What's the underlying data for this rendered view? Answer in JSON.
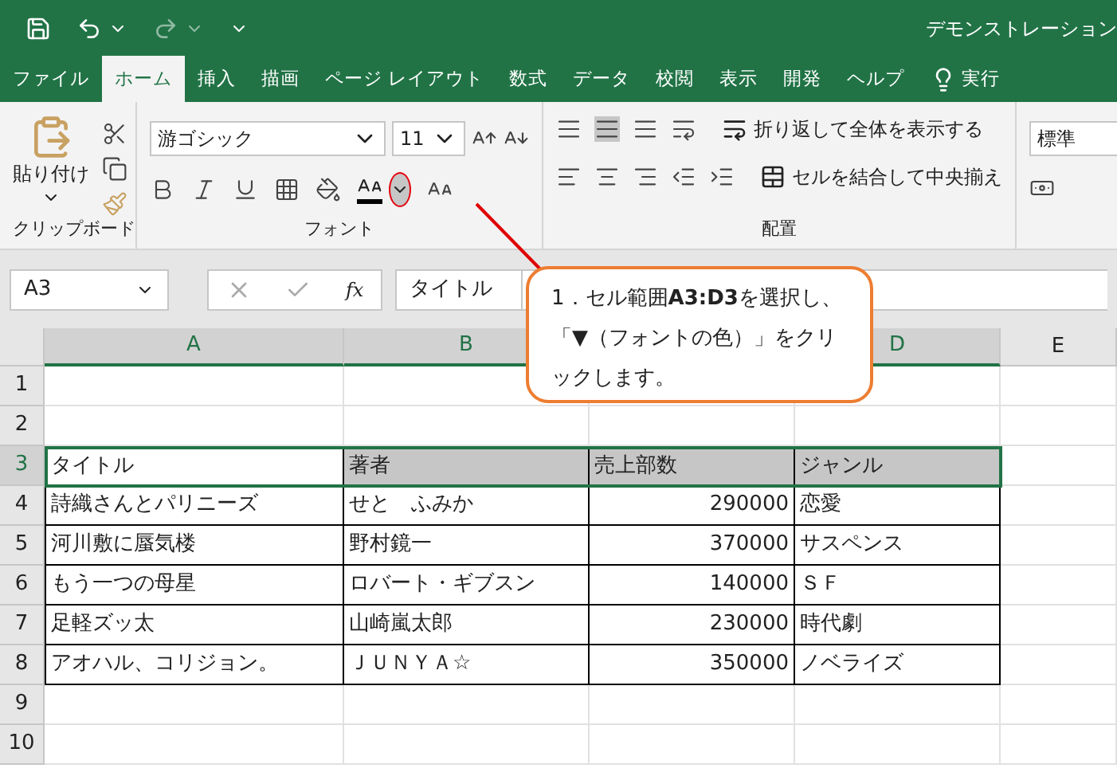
{
  "window": {
    "title": "デモンストレーション"
  },
  "ribbon_tabs": [
    {
      "label": "ファイル",
      "selected": false
    },
    {
      "label": "ホーム",
      "selected": true
    },
    {
      "label": "挿入",
      "selected": false
    },
    {
      "label": "描画",
      "selected": false
    },
    {
      "label": "ページ レイアウト",
      "selected": false
    },
    {
      "label": "数式",
      "selected": false
    },
    {
      "label": "データ",
      "selected": false
    },
    {
      "label": "校閲",
      "selected": false
    },
    {
      "label": "表示",
      "selected": false
    },
    {
      "label": "開発",
      "selected": false
    },
    {
      "label": "ヘルプ",
      "selected": false
    },
    {
      "label": "実行",
      "selected": false
    }
  ],
  "ribbon": {
    "paste": "貼り付け",
    "font_name": "游ゴシック",
    "font_size": "11",
    "wrap_text": "折り返して全体を表示する",
    "merge_center": "セルを結合して中央揃え",
    "number_format": "標準",
    "groups": [
      "クリップボード",
      "フォント",
      "配置"
    ]
  },
  "name_box": "A3",
  "function_symbol": "fx",
  "formula": "タイトル",
  "columns": [
    {
      "label": "A",
      "selected": true
    },
    {
      "label": "B",
      "selected": true
    },
    {
      "label": "D",
      "selected": true
    },
    {
      "label": "E",
      "selected": false
    }
  ],
  "rows": [
    {
      "label": "1",
      "selected": false
    },
    {
      "label": "2",
      "selected": false
    },
    {
      "label": "3",
      "selected": true
    },
    {
      "label": "4",
      "selected": false
    },
    {
      "label": "5",
      "selected": false
    },
    {
      "label": "6",
      "selected": false
    },
    {
      "label": "7",
      "selected": false
    },
    {
      "label": "8",
      "selected": false
    },
    {
      "label": "9",
      "selected": false
    },
    {
      "label": "10",
      "selected": false
    }
  ],
  "table": [
    {
      "selected": true,
      "cells": [
        {
          "text": "タイトル"
        },
        {
          "text": "著者"
        },
        {
          "text": "売上部数"
        },
        {
          "text": "ジャンル"
        }
      ]
    },
    {
      "selected": false,
      "cells": [
        {
          "text": "詩織さんとパリニーズ"
        },
        {
          "text": "せと　ふみか"
        },
        {
          "text": "290000",
          "kind": "number"
        },
        {
          "text": "恋愛"
        }
      ]
    },
    {
      "selected": false,
      "cells": [
        {
          "text": "河川敷に蜃気楼"
        },
        {
          "text": "野村鏡一"
        },
        {
          "text": "370000",
          "kind": "number"
        },
        {
          "text": "サスペンス"
        }
      ]
    },
    {
      "selected": false,
      "cells": [
        {
          "text": "もう一つの母星"
        },
        {
          "text": "ロバート・ギブスン"
        },
        {
          "text": "140000",
          "kind": "number"
        },
        {
          "text": "ＳＦ"
        }
      ]
    },
    {
      "selected": false,
      "cells": [
        {
          "text": "足軽ズッ太"
        },
        {
          "text": "山崎嵐太郎"
        },
        {
          "text": "230000",
          "kind": "number"
        },
        {
          "text": "時代劇"
        }
      ]
    },
    {
      "selected": false,
      "cells": [
        {
          "text": "アオハル、コリジョン。"
        },
        {
          "text": "ＪＵＮＹＡ☆"
        },
        {
          "text": "350000",
          "kind": "number"
        },
        {
          "text": "ノベライズ"
        }
      ]
    }
  ],
  "callout": "1．セル範囲**A3:D3**を選択し、「▼（フォントの色）」をクリックします。"
}
